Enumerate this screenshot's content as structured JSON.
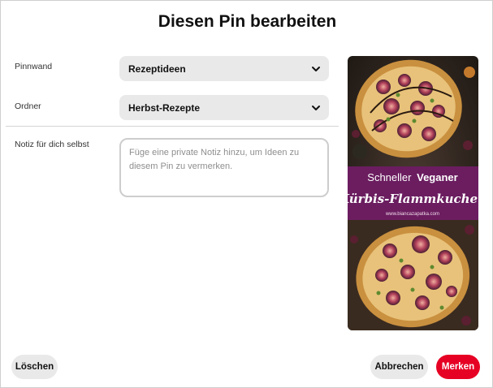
{
  "dialog": {
    "title": "Diesen Pin bearbeiten"
  },
  "fields": {
    "board_label": "Pinnwand",
    "board_value": "Rezeptideen",
    "section_label": "Ordner",
    "section_value": "Herbst-Rezepte",
    "note_label": "Notiz für dich selbst",
    "note_placeholder": "Füge eine private Notiz hinzu, um Ideen zu diesem Pin zu vermerken.",
    "note_value": ""
  },
  "pin_image": {
    "text_line1_a": "Schneller",
    "text_line1_b": "Veganer",
    "text_line2": "Kürbis-Flammkuchen",
    "url": "www.biancazapatka.com"
  },
  "buttons": {
    "delete": "Löschen",
    "cancel": "Abbrechen",
    "save": "Merken"
  },
  "colors": {
    "save_button": "#e60023",
    "pin_banner": "#6b1d60",
    "field_background": "#e9e9e9"
  },
  "icons": {
    "dropdown": "chevron-down-icon"
  }
}
